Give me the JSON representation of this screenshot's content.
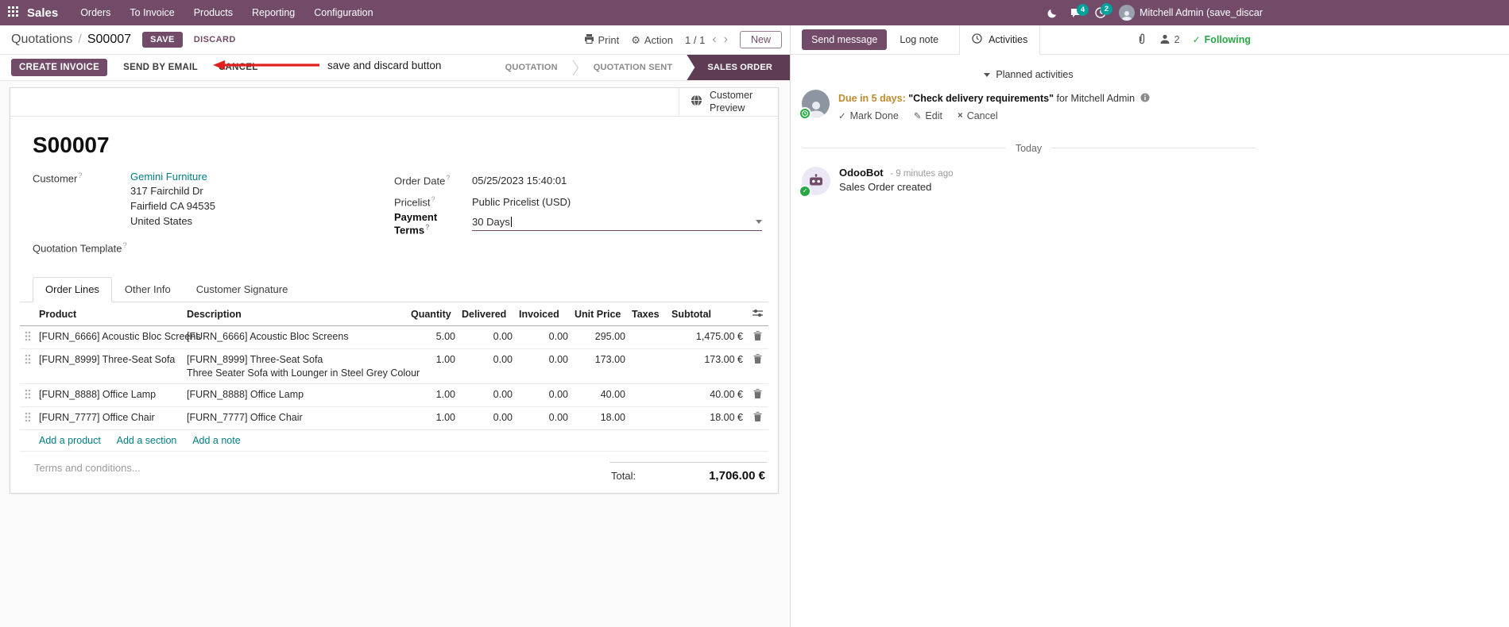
{
  "topbar": {
    "brand": "Sales",
    "menus": [
      "Orders",
      "To Invoice",
      "Products",
      "Reporting",
      "Configuration"
    ],
    "messages_badge": "4",
    "activities_badge": "2",
    "user_name": "Mitchell Admin (save_discar"
  },
  "control_panel": {
    "breadcrumb_parent": "Quotations",
    "breadcrumb_separator": "/",
    "breadcrumb_current": "S00007",
    "save_label": "SAVE",
    "discard_label": "DISCARD",
    "annotation_label": "save and discard button",
    "print_label": "Print",
    "action_label": "Action",
    "pager_value": "1 / 1",
    "new_label": "New"
  },
  "statusbar": {
    "create_invoice_label": "CREATE INVOICE",
    "send_by_email_label": "SEND BY EMAIL",
    "cancel_label": "CANCEL",
    "stages": [
      "QUOTATION",
      "QUOTATION SENT",
      "SALES ORDER"
    ],
    "active_stage": "SALES ORDER"
  },
  "form": {
    "preview_label": "Customer Preview",
    "title": "S00007",
    "customer": {
      "label": "Customer",
      "name": "Gemini Furniture",
      "street": "317 Fairchild Dr",
      "city": "Fairfield CA 94535",
      "country": "United States"
    },
    "quotation_template": {
      "label": "Quotation Template"
    },
    "order_date": {
      "label": "Order Date",
      "value": "05/25/2023 15:40:01"
    },
    "pricelist": {
      "label": "Pricelist",
      "value": "Public Pricelist (USD)"
    },
    "payment_terms": {
      "label": "Payment Terms",
      "value": "30 Days"
    },
    "tabs": [
      "Order Lines",
      "Other Info",
      "Customer Signature"
    ],
    "order_lines": {
      "headers": {
        "product": "Product",
        "description": "Description",
        "quantity": "Quantity",
        "delivered": "Delivered",
        "invoiced": "Invoiced",
        "unit_price": "Unit Price",
        "taxes": "Taxes",
        "subtotal": "Subtotal"
      },
      "rows": [
        {
          "product": "[FURN_6666] Acoustic Bloc Screens",
          "description": "[FURN_6666] Acoustic Bloc Screens",
          "description_line2": "",
          "quantity": "5.00",
          "delivered": "0.00",
          "invoiced": "0.00",
          "unit_price": "295.00",
          "taxes": "",
          "subtotal": "1,475.00 €"
        },
        {
          "product": "[FURN_8999] Three-Seat Sofa",
          "description": "[FURN_8999] Three-Seat Sofa",
          "description_line2": "Three Seater Sofa with Lounger in Steel Grey Colour",
          "quantity": "1.00",
          "delivered": "0.00",
          "invoiced": "0.00",
          "unit_price": "173.00",
          "taxes": "",
          "subtotal": "173.00 €"
        },
        {
          "product": "[FURN_8888] Office Lamp",
          "description": "[FURN_8888] Office Lamp",
          "description_line2": "",
          "quantity": "1.00",
          "delivered": "0.00",
          "invoiced": "0.00",
          "unit_price": "40.00",
          "taxes": "",
          "subtotal": "40.00 €"
        },
        {
          "product": "[FURN_7777] Office Chair",
          "description": "[FURN_7777] Office Chair",
          "description_line2": "",
          "quantity": "1.00",
          "delivered": "0.00",
          "invoiced": "0.00",
          "unit_price": "18.00",
          "taxes": "",
          "subtotal": "18.00 €"
        }
      ],
      "add_product": "Add a product",
      "add_section": "Add a section",
      "add_note": "Add a note"
    },
    "terms_placeholder": "Terms and conditions...",
    "total_label": "Total:",
    "total_value": "1,706.00 €"
  },
  "chatter": {
    "send_message": "Send message",
    "log_note": "Log note",
    "activities_tab": "Activities",
    "followers_count": "2",
    "following": "Following",
    "planned_activities_header": "Planned activities",
    "activity": {
      "due": "Due in 5 days:",
      "summary": "\"Check delivery requirements\"",
      "assignee": "for Mitchell Admin",
      "mark_done": "Mark Done",
      "edit": "Edit",
      "cancel": "Cancel"
    },
    "day_divider": "Today",
    "message": {
      "author": "OdooBot",
      "time": "- 9 minutes ago",
      "body": "Sales Order created"
    }
  },
  "icons": {
    "pager_prev": "‹",
    "pager_next": "›",
    "gear": "⚙",
    "check": "✓",
    "pencil": "✎",
    "cross": "×",
    "help": "?"
  }
}
